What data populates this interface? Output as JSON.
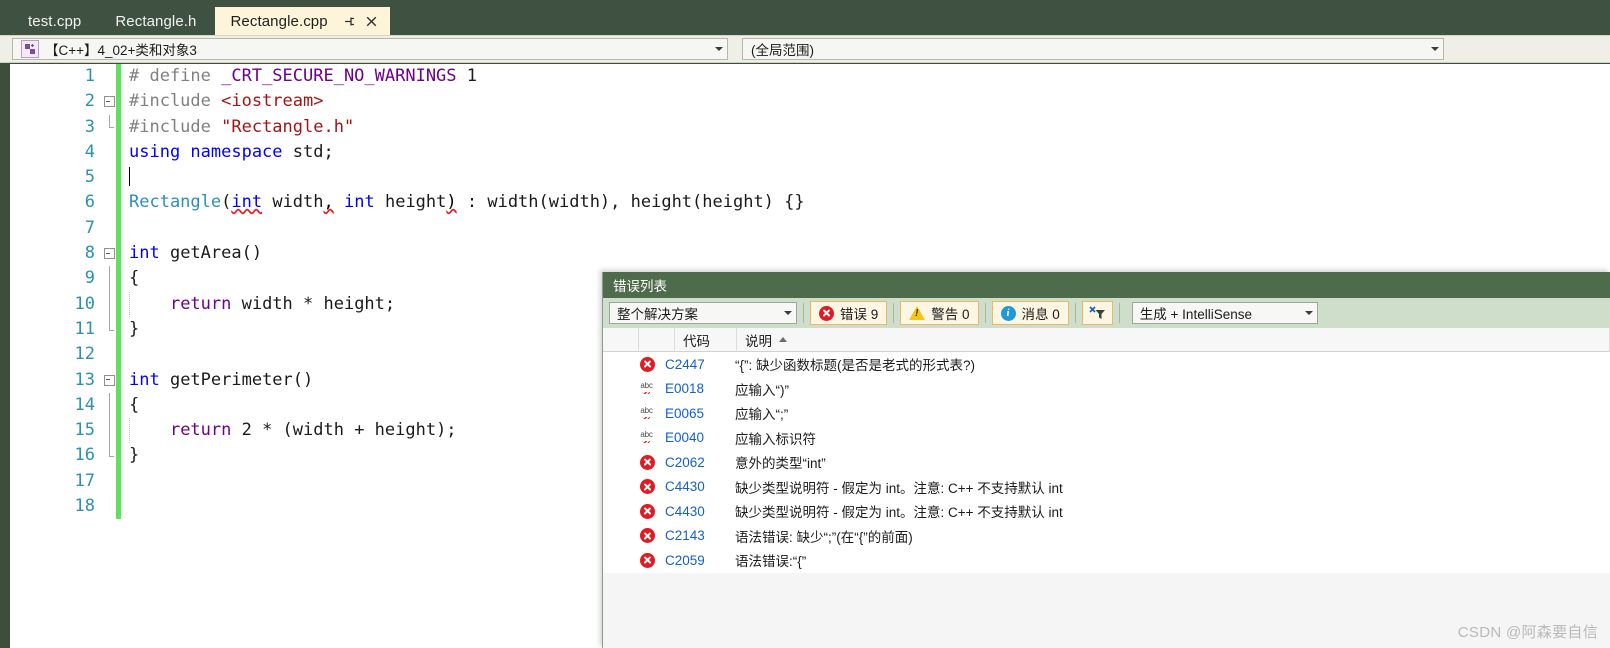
{
  "window": {
    "accent_green": "#3f5140",
    "active_tab_bg": "#fdf4da"
  },
  "tabs": [
    {
      "label": "test.cpp",
      "active": false
    },
    {
      "label": "Rectangle.h",
      "active": false
    },
    {
      "label": "Rectangle.cpp",
      "active": true
    }
  ],
  "tab_icons": {
    "pin": "pin-icon",
    "close": "close-icon"
  },
  "navbar": {
    "project_scope": "【C++】4_02+类和对象3",
    "member_scope": "(全局范围)",
    "context_icon": "context-switcher-icon"
  },
  "editor": {
    "lines": [
      {
        "n": 1,
        "text": "# define _CRT_SECURE_NO_WARNINGS 1"
      },
      {
        "n": 2,
        "text": "#include <iostream>"
      },
      {
        "n": 3,
        "text": "#include \"Rectangle.h\""
      },
      {
        "n": 4,
        "text": "using namespace std;"
      },
      {
        "n": 5,
        "text": ""
      },
      {
        "n": 6,
        "text": "Rectangle(int width, int height) : width(width), height(height) {}"
      },
      {
        "n": 7,
        "text": ""
      },
      {
        "n": 8,
        "text": "int getArea()"
      },
      {
        "n": 9,
        "text": "{"
      },
      {
        "n": 10,
        "text": "    return width * height;"
      },
      {
        "n": 11,
        "text": "}"
      },
      {
        "n": 12,
        "text": ""
      },
      {
        "n": 13,
        "text": "int getPerimeter()"
      },
      {
        "n": 14,
        "text": "{"
      },
      {
        "n": 15,
        "text": "    return 2 * (width + height);"
      },
      {
        "n": 16,
        "text": "}"
      },
      {
        "n": 17,
        "text": ""
      },
      {
        "n": 18,
        "text": ""
      }
    ]
  },
  "error_list": {
    "title": "错误列表",
    "scope_filter": "整个解决方案",
    "build_filter": "生成 + IntelliSense",
    "counters": {
      "errors": "错误 9",
      "warnings": "警告 0",
      "messages": "消息 0"
    },
    "clear_filter_icon": "clear-filter-icon",
    "columns": [
      "",
      "",
      "代码",
      "说明"
    ],
    "sort_column": "说明",
    "rows": [
      {
        "severity": "error",
        "code": "C2447",
        "description": "“{”: 缺少函数标题(是否是老式的形式表?)"
      },
      {
        "severity": "intellisense",
        "code": "E0018",
        "description": "应输入“)”"
      },
      {
        "severity": "intellisense",
        "code": "E0065",
        "description": "应输入“;”"
      },
      {
        "severity": "intellisense",
        "code": "E0040",
        "description": "应输入标识符"
      },
      {
        "severity": "error",
        "code": "C2062",
        "description": "意外的类型“int”"
      },
      {
        "severity": "error",
        "code": "C4430",
        "description": "缺少类型说明符 - 假定为 int。注意: C++ 不支持默认 int"
      },
      {
        "severity": "error",
        "code": "C4430",
        "description": "缺少类型说明符 - 假定为 int。注意: C++ 不支持默认 int"
      },
      {
        "severity": "error",
        "code": "C2143",
        "description": "语法错误: 缺少“;”(在“{”的前面)"
      },
      {
        "severity": "error",
        "code": "C2059",
        "description": "语法错误:“{”"
      }
    ]
  },
  "watermark": "CSDN @阿森要自信"
}
